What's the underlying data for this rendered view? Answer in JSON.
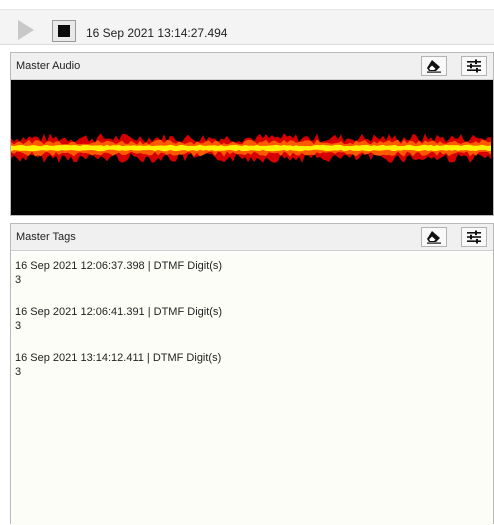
{
  "toolbar": {
    "timestamp": "16 Sep 2021 13:14:27.494"
  },
  "audio_panel": {
    "title": "Master Audio"
  },
  "tags_panel": {
    "title": "Master Tags",
    "entries": [
      {
        "header": "16 Sep 2021 12:06:37.398 | DTMF Digit(s)",
        "value": "3"
      },
      {
        "header": "16 Sep 2021 12:06:41.391 | DTMF Digit(s)",
        "value": "3"
      },
      {
        "header": "16 Sep 2021 13:14:12.411 | DTMF Digit(s)",
        "value": "3"
      }
    ]
  },
  "icons": {
    "play": "play-icon",
    "stop": "stop-icon",
    "eraser": "eraser-icon",
    "settings": "sliders-icon"
  },
  "colors": {
    "waveform_outer": "#d60000",
    "waveform_mid": "#ff5a00",
    "waveform_core": "#fff200",
    "waveform_bg": "#000000"
  }
}
